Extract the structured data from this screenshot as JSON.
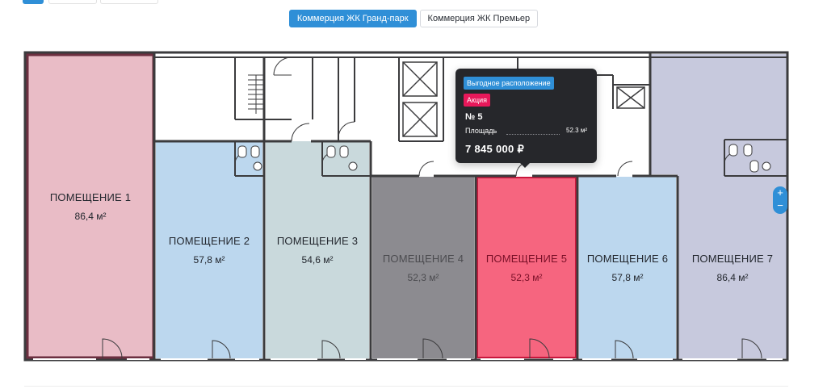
{
  "tabs": [
    {
      "label": "Коммерция ЖК Гранд-парк",
      "active": true
    },
    {
      "label": "Коммерция ЖК Премьер",
      "active": false
    }
  ],
  "rooms": [
    {
      "name": "ПОМЕЩЕНИЕ 1",
      "area": "86,4 м²",
      "color": "#e9bcc6"
    },
    {
      "name": "ПОМЕЩЕНИЕ 2",
      "area": "57,8 м²",
      "color": "#bcd7ee"
    },
    {
      "name": "ПОМЕЩЕНИЕ 3",
      "area": "54,6 м²",
      "color": "#c9d9dc"
    },
    {
      "name": "ПОМЕЩЕНИЕ 4",
      "area": "52,3 м²",
      "color": "#8c8b90"
    },
    {
      "name": "ПОМЕЩЕНИЕ 5",
      "area": "52,3 м²",
      "color": "#f6657f"
    },
    {
      "name": "ПОМЕЩЕНИЕ 6",
      "area": "57,8 м²",
      "color": "#bcd7ee"
    },
    {
      "name": "ПОМЕЩЕНИЕ 7",
      "area": "86,4 м²",
      "color": "#c7c9dd"
    }
  ],
  "tooltip": {
    "badge_primary": "Выгодное расположение",
    "badge_secondary": "Акция",
    "number": "№ 5",
    "area_label": "Площадь",
    "area_value": "52.3 м²",
    "price": "7 845 000 ₽"
  },
  "zoom": {
    "plus": "+",
    "minus": "−"
  },
  "colors": {
    "accent": "#2f8fd7",
    "sale_badge": "#e8185a",
    "wall": "#3b3b3d",
    "tooltip_bg": "#26272b"
  }
}
